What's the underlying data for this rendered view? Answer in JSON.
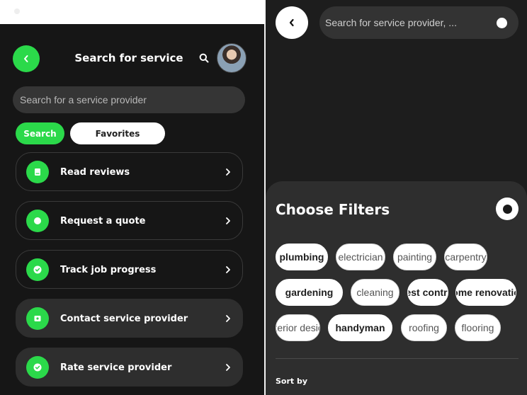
{
  "left": {
    "title": "Search for service",
    "search_placeholder": "Search for a service provider",
    "tabs": [
      {
        "label": "Search"
      },
      {
        "label": "Favorites"
      }
    ],
    "items": [
      {
        "label": "Read reviews",
        "icon": "book-icon"
      },
      {
        "label": "Request a quote",
        "icon": "circle-icon"
      },
      {
        "label": "Track job progress",
        "icon": "check-circle-icon"
      },
      {
        "label": "Contact service provider",
        "icon": "contact-icon"
      },
      {
        "label": "Rate service provider",
        "icon": "check-circle-icon"
      }
    ]
  },
  "right": {
    "search_placeholder": "Search for service provider, ...",
    "filters_title": "Choose Filters",
    "chips": [
      {
        "label": "plumbing",
        "selected": true
      },
      {
        "label": "electrician",
        "selected": false
      },
      {
        "label": "painting",
        "selected": false
      },
      {
        "label": "carpentry",
        "selected": false
      },
      {
        "label": "gardening",
        "selected": true
      },
      {
        "label": "cleaning",
        "selected": false
      },
      {
        "label": "pest control",
        "selected": true
      },
      {
        "label": "home renovation",
        "selected": true
      },
      {
        "label": "interior design",
        "selected": false
      },
      {
        "label": "handyman",
        "selected": true
      },
      {
        "label": "roofing",
        "selected": false
      },
      {
        "label": "flooring",
        "selected": false
      }
    ],
    "sort_label": "Sort by"
  },
  "colors": {
    "accent": "#2bd94a",
    "background": "#161616",
    "surface": "#2e2e2e"
  }
}
